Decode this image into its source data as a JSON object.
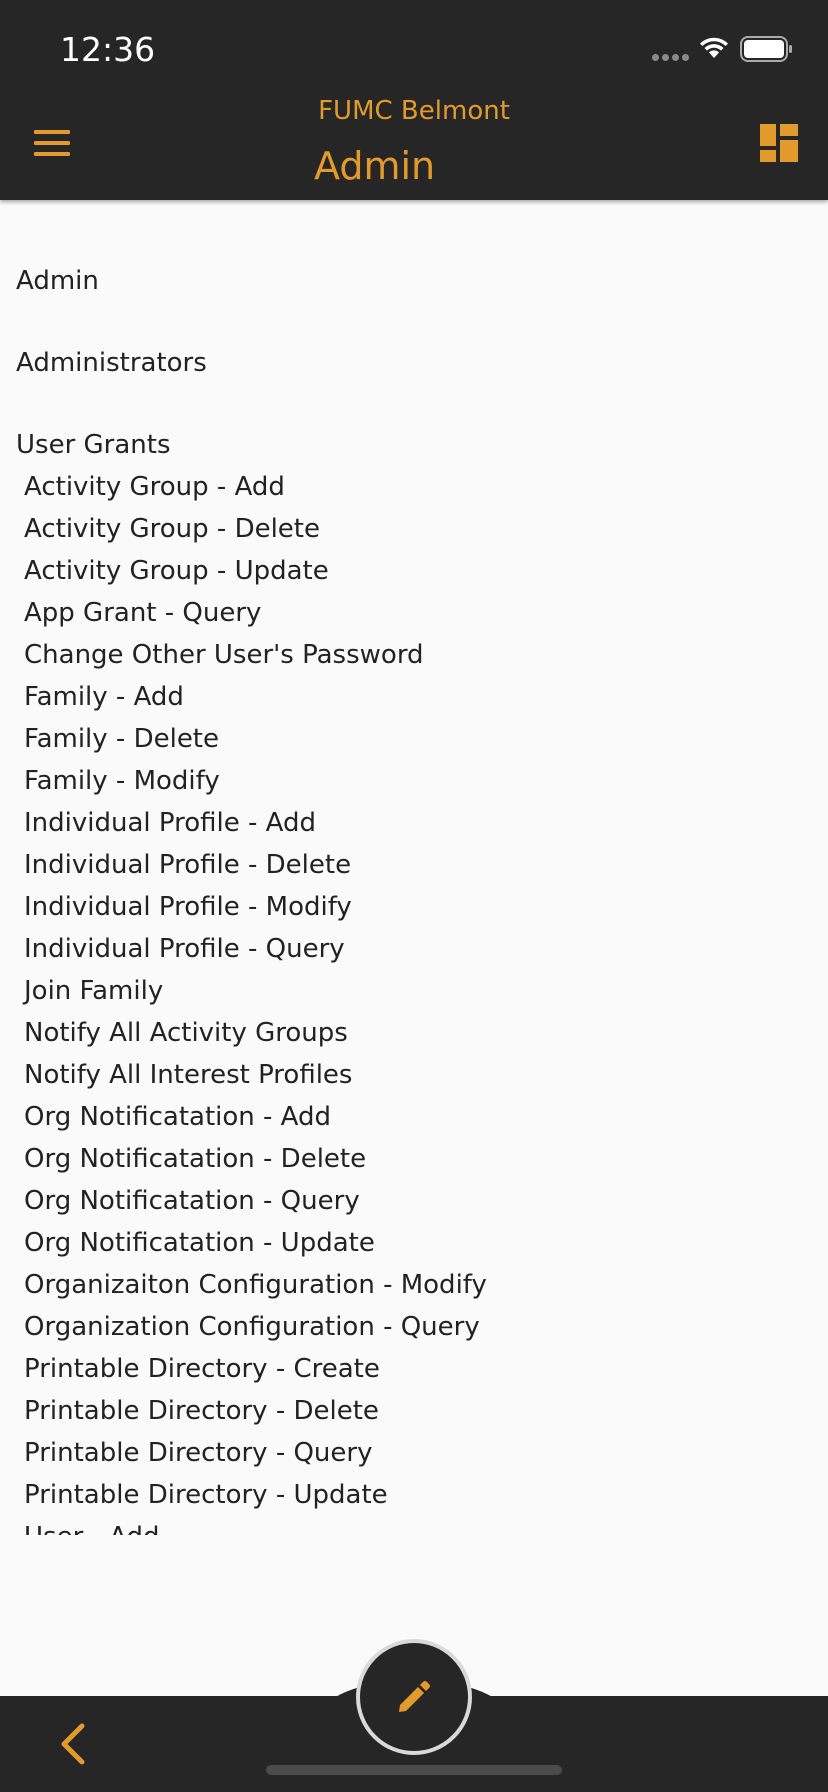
{
  "status_bar": {
    "time": "12:36"
  },
  "header": {
    "org_name": "FUMC Belmont",
    "title": "Admin",
    "accent_color": "#e39a2d"
  },
  "sections": {
    "admin": "Admin",
    "administrators": "Administrators",
    "user_grants": "User Grants"
  },
  "grants": [
    "Activity Group - Add",
    "Activity Group - Delete",
    "Activity Group - Update",
    "App Grant - Query",
    "Change Other User's Password",
    "Family - Add",
    "Family - Delete",
    "Family - Modify",
    "Individual Profile - Add",
    "Individual Profile - Delete",
    "Individual Profile - Modify",
    "Individual Profile - Query",
    "Join Family",
    "Notify All Activity Groups",
    "Notify All Interest Profiles",
    "Org Notificatation - Add",
    "Org Notificatation - Delete",
    "Org Notificatation - Query",
    "Org Notificatation - Update",
    "Organizaiton Configuration - Modify",
    "Organization Configuration - Query",
    "Printable Directory - Create",
    "Printable Directory - Delete",
    "Printable Directory - Query",
    "Printable Directory - Update",
    "User - Add"
  ],
  "icons": {
    "menu": "hamburger-menu-icon",
    "dashboard": "dashboard-grid-icon",
    "edit": "pencil-icon",
    "back": "chevron-left-icon"
  }
}
